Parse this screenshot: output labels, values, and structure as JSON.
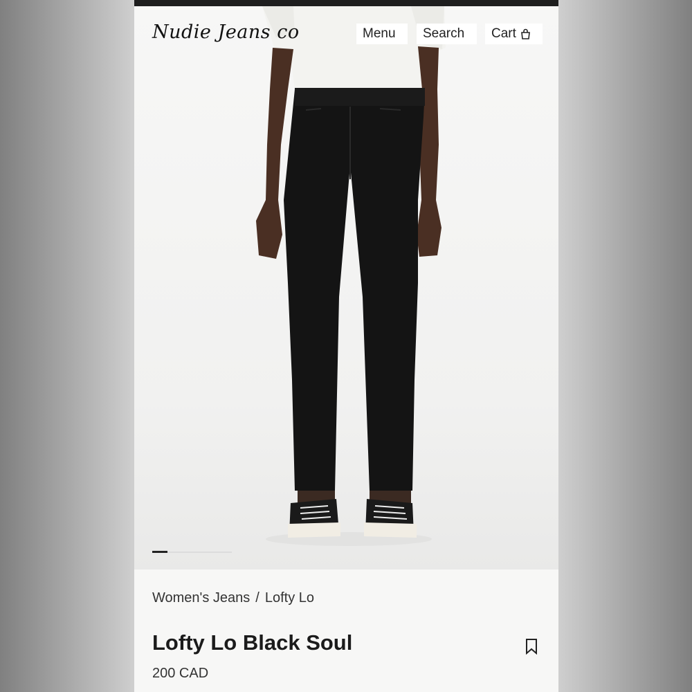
{
  "brand": {
    "logo_text": "Nudie Jeans co"
  },
  "nav": {
    "menu_label": "Menu",
    "search_label": "Search",
    "cart_label": "Cart"
  },
  "gallery": {
    "current_index": 1,
    "image_description_icon": "model-wearing-black-jeans"
  },
  "breadcrumb": {
    "items": [
      "Women's Jeans",
      "Lofty Lo"
    ],
    "separator": "/"
  },
  "product": {
    "name": "Lofty Lo Black Soul",
    "price": "200 CAD"
  },
  "icons": {
    "cart": "bag-icon",
    "bookmark": "bookmark-icon"
  },
  "colors": {
    "background": "#f5f5f4",
    "text": "#1b1b1b",
    "topbar": "#1e1e1e"
  }
}
